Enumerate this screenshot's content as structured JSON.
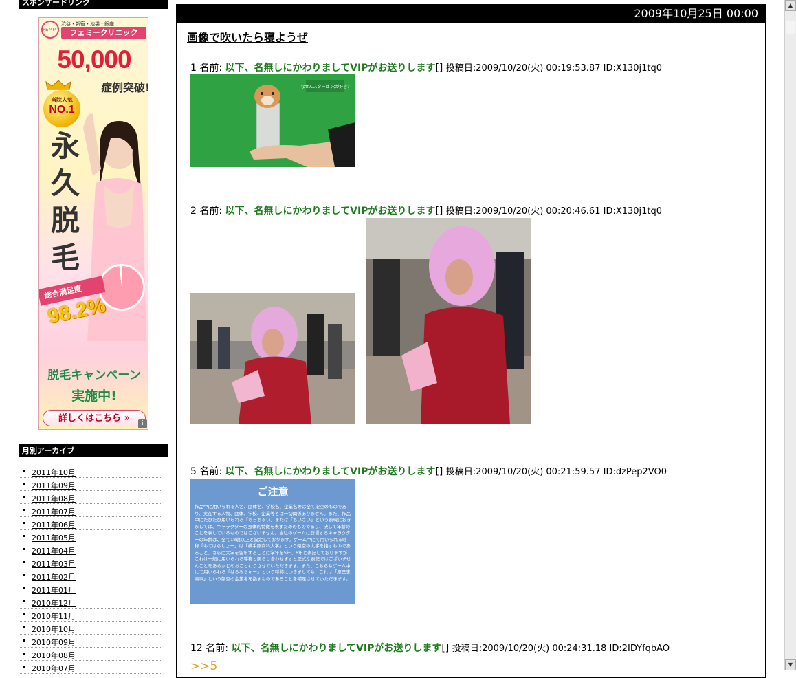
{
  "sidebar": {
    "sponsor_heading": "スポンサードリンク",
    "archive_heading": "月別アーカイブ",
    "archive_items": [
      "2011年10月",
      "2011年09月",
      "2011年08月",
      "2011年07月",
      "2011年06月",
      "2011年05月",
      "2011年04月",
      "2011年03月",
      "2011年02月",
      "2011年01月",
      "2010年12月",
      "2010年11月",
      "2010年10月",
      "2010年09月",
      "2010年08月",
      "2010年07月"
    ]
  },
  "ad": {
    "mark": "FEMMY",
    "clinic_sub": "渋谷・新宿・池袋・銀座",
    "clinic_name": "フェミークリニック",
    "number": "50,000",
    "number_sub": "症例突破!",
    "medal_top": "当院人気",
    "medal_main": "NO.1",
    "vertical_text": "永久脱毛",
    "satisfaction_label": "総合満足度",
    "satisfaction_pct": "98.2%",
    "satisfaction_value": 98.2,
    "campaign_line1": "脱毛キャンペーン",
    "campaign_line2": "実施中!",
    "cta": "詳しくはこちら",
    "info": "i"
  },
  "main": {
    "date": "2009年10月25日 00:00",
    "title": "画像で吹いたら寝ようぜ",
    "posts": [
      {
        "num": "1",
        "label": "名前:",
        "name": "以下、名無しにかわりましてVIPがお送りします",
        "brackets": "[]",
        "meta": "投稿日:2009/10/20(火) 00:19:53.87 ID:X130j1tq0"
      },
      {
        "num": "2",
        "label": "名前:",
        "name": "以下、名無しにかわりましてVIPがお送りします",
        "brackets": "[]",
        "meta": "投稿日:2009/10/20(火) 00:20:46.61 ID:X130j1tq0"
      },
      {
        "num": "5",
        "label": "名前:",
        "name": "以下、名無しにかわりましてVIPがお送りします",
        "brackets": "[]",
        "meta": "投稿日:2009/10/20(火) 00:21:59.57 ID:dzPep2VO0"
      },
      {
        "num": "12",
        "label": "名前:",
        "name": "以下、名無しにかわりましてVIPがお送りします",
        "brackets": "[]",
        "meta": "投稿日:2009/10/20(火) 00:24:31.18 ID:2IDYfqbAO"
      }
    ],
    "reply_link": ">>5",
    "image1_caption": "なぜんスターは 穴が好き?",
    "notice": {
      "title": "ご注意",
      "text": "作品中に用いられる人名、団体名、学校名、企業名等は全て架空のものであり、実在する人物、団体、学校、企業等とは一切関係ありません。また、作品中にたびたび用いられる「ちっちゃい」または「ちいさい」という表現におきましては、キャラクターの身体的特徴を表すためのものであり、決して年齢のことを表しているものではございません。当社のゲームに登場するキャラクターの年齢は、全て18歳以上と設定しております。ゲーム中にて用いられる呼称「もてはらしょー」は「横手原商科大学」という架空の大学を指すものであること、さらに大学を留年することに学年を5年、6年と表記しておりますがこれは一般に用いられる呼称と照らし合わせますと正式な表記ではございませんことをあらかじめおことわりさせていただきます。また、こちらもゲーム中にて用いられる「はらみちゅー」という呼称につきましても、これは「原巳忠商事」という架空の企業名を指すものであることを補足させていただきます。"
    }
  },
  "icons": {
    "scroll_up": "▲",
    "scroll_down": "▼"
  }
}
